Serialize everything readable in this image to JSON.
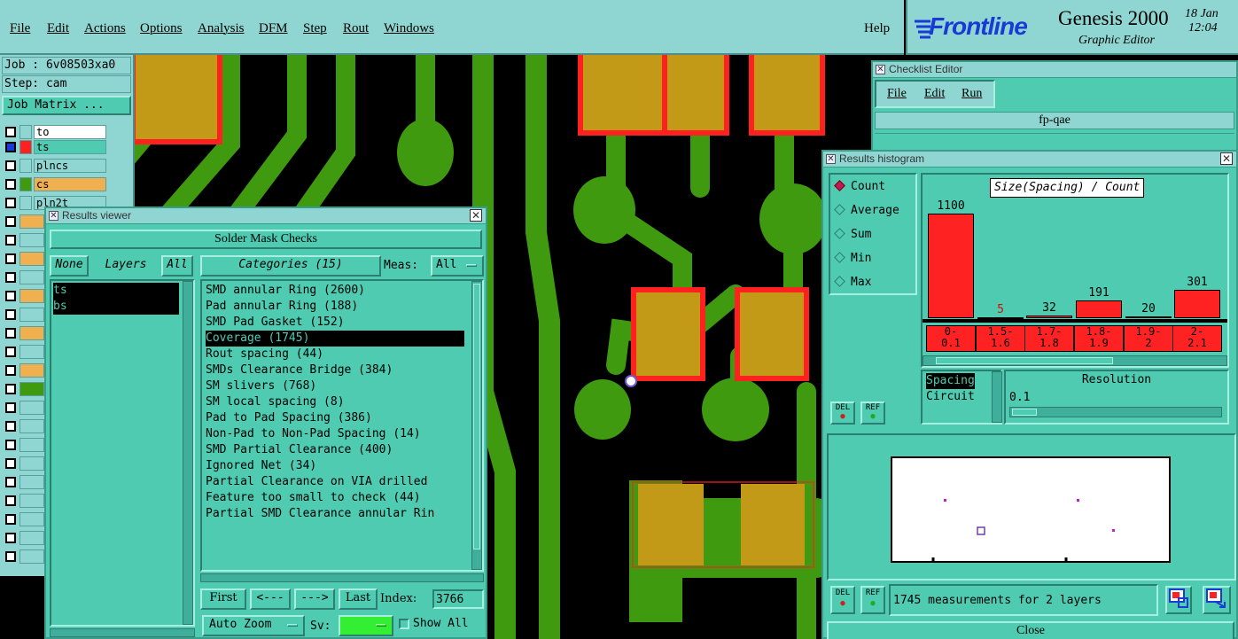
{
  "menu": {
    "items": [
      "File",
      "Edit",
      "Actions",
      "Options",
      "Analysis",
      "DFM",
      "Step",
      "Rout",
      "Windows"
    ],
    "help": "Help"
  },
  "brand": {
    "logo": "Frontline",
    "product": "Genesis 2000",
    "subtitle": "Graphic Editor",
    "date": "18 Jan",
    "time": "12:04"
  },
  "job_panel": {
    "job": "Job : 6v08503xa0",
    "step": "Step: cam",
    "matrix_button": "Job Matrix ...",
    "layers": [
      {
        "name": "to",
        "color": "#ffffff"
      },
      {
        "name": "ts",
        "color": "#4fcbb2"
      },
      {
        "name": "plncs",
        "color": "#8fd6d2"
      },
      {
        "name": "cs",
        "color": "#f0b050"
      },
      {
        "name": "pln2t",
        "color": "#8fd6d2"
      }
    ]
  },
  "results_viewer": {
    "title": "Results viewer",
    "header": "Solder Mask Checks",
    "none_button": "None",
    "layers_label": "Layers",
    "all_button": "All",
    "layers": [
      "ts",
      "bs"
    ],
    "categories_label": "Categories (15)",
    "meas_label": "Meas:",
    "meas_value": "All",
    "categories": [
      "SMD annular Ring (2600)",
      "Pad annular Ring (188)",
      "SMD Pad Gasket (152)",
      "Coverage (1745)",
      "Rout spacing (44)",
      "SMDs Clearance Bridge (384)",
      "SM slivers (768)",
      "SM local spacing (8)",
      "Pad to Pad Spacing (386)",
      "Non-Pad to Non-Pad Spacing (14)",
      "SMD Partial Clearance (400)",
      "Ignored Net (34)",
      "Partial Clearance on VIA drilled",
      "Feature too small to check (44)",
      "Partial SMD Clearance annular Rin"
    ],
    "selected_index": 3,
    "nav": {
      "first": "First",
      "prev": "<---",
      "next": "--->",
      "last": "Last",
      "index_label": "Index:",
      "index_value": "3766"
    },
    "auto_zoom": "Auto Zoom",
    "sv_label": "Sv:",
    "show_all": "Show All"
  },
  "checklist_editor": {
    "title": "Checklist Editor",
    "menu": [
      "File",
      "Edit",
      "Run"
    ],
    "name": "fp-qae"
  },
  "histogram": {
    "title": "Results histogram",
    "modes": [
      "Count",
      "Average",
      "Sum",
      "Min",
      "Max"
    ],
    "selected_mode": "Count",
    "chart_title": "Size(Spacing) / Count",
    "bins": [
      "0-\n0.1",
      "1.5-\n1.6",
      "1.7-\n1.8",
      "1.8-\n1.9",
      "1.9-\n2",
      "2-\n2.1"
    ],
    "bin_labels": [
      [
        "0-",
        "0.1"
      ],
      [
        "1.5-",
        "1.6"
      ],
      [
        "1.7-",
        "1.8"
      ],
      [
        "1.8-",
        "1.9"
      ],
      [
        "1.9-",
        "2"
      ],
      [
        "2-",
        "2.1"
      ]
    ],
    "counts": [
      1100,
      5,
      32,
      191,
      20,
      301
    ],
    "count_labels": [
      "1100",
      "5",
      "32",
      "191",
      "20",
      "301"
    ],
    "measure_options": [
      "Spacing",
      "Circuit"
    ],
    "resolution_label": "Resolution",
    "resolution_value": "0.1",
    "del_label": "DEL",
    "ref_label": "REF",
    "status": "1745 measurements for 2 layers",
    "close": "Close"
  },
  "colors": {
    "window_bg": "#4fcbb2",
    "panel_bg": "#8fd6d2",
    "copper": "#3f9a10",
    "pad": "#c29a18",
    "mask_red": "#ff2020"
  }
}
